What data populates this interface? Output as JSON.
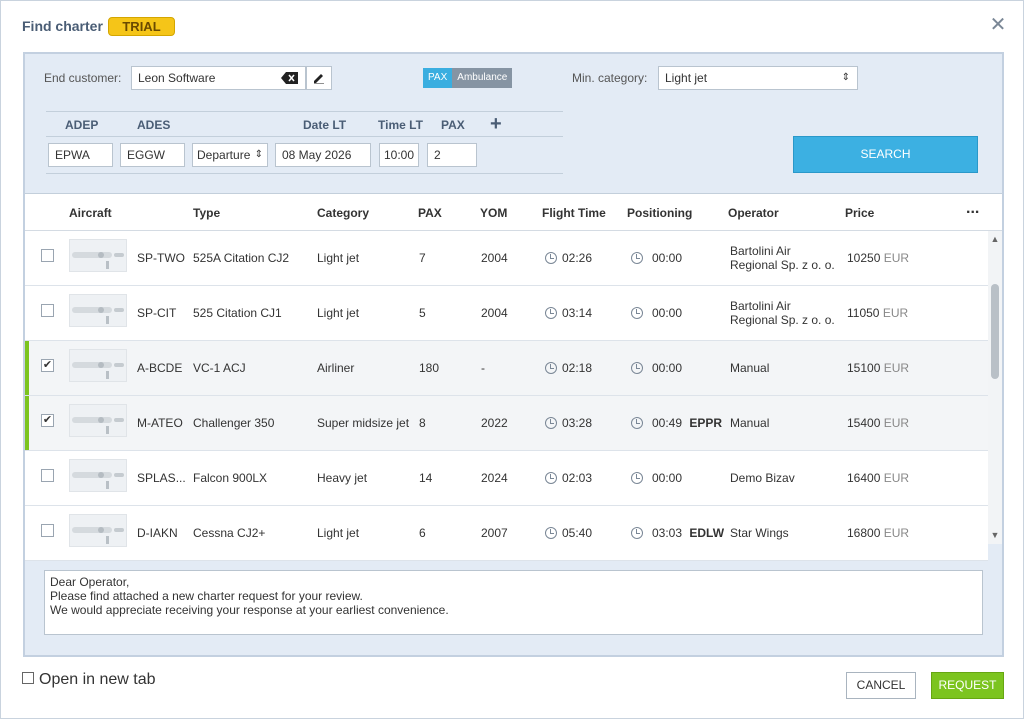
{
  "dialog": {
    "title": "Find charter",
    "badge": "TRIAL",
    "close_icon": "close-icon"
  },
  "filters": {
    "end_customer_label": "End customer:",
    "end_customer_value": "Leon Software",
    "toggle": {
      "pax": "PAX",
      "ambulance": "Ambulance",
      "selected": "PAX"
    },
    "min_category_label": "Min. category:",
    "min_category_value": "Light jet"
  },
  "route": {
    "headers": [
      "ADEP",
      "ADES",
      "Date LT",
      "Time LT",
      "PAX"
    ],
    "adep": "EPWA",
    "ades": "EGGW",
    "mode": "Departure",
    "date": "08 May 2026",
    "time": "10:00",
    "pax": "2"
  },
  "search_label": "SEARCH",
  "table": {
    "headers": [
      "Aircraft",
      "Type",
      "Category",
      "PAX",
      "YOM",
      "Flight Time",
      "Positioning",
      "Operator",
      "Price"
    ],
    "more_icon": "...",
    "rows": [
      {
        "reg": "SP-TWO",
        "type": "525A Citation CJ2",
        "category": "Light jet",
        "pax": "7",
        "yom": "2004",
        "flight_time": "02:26",
        "positioning": "00:00",
        "pos_airport": "",
        "operator1": "Bartolini Air",
        "operator2": "Regional Sp. z o. o.",
        "price": "10250",
        "currency": "EUR",
        "checked": false
      },
      {
        "reg": "SP-CIT",
        "type": "525 Citation CJ1",
        "category": "Light jet",
        "pax": "5",
        "yom": "2004",
        "flight_time": "03:14",
        "positioning": "00:00",
        "pos_airport": "",
        "operator1": "Bartolini Air",
        "operator2": "Regional Sp. z o. o.",
        "price": "11050",
        "currency": "EUR",
        "checked": false
      },
      {
        "reg": "A-BCDE",
        "type": "VC-1 ACJ",
        "category": "Airliner",
        "pax": "180",
        "yom": "-",
        "flight_time": "02:18",
        "positioning": "00:00",
        "pos_airport": "",
        "operator1": "Manual",
        "operator2": "",
        "price": "15100",
        "currency": "EUR",
        "checked": true
      },
      {
        "reg": "M-ATEO",
        "type": "Challenger 350",
        "category": "Super midsize jet",
        "pax": "8",
        "yom": "2022",
        "flight_time": "03:28",
        "positioning": "00:49",
        "pos_airport": "EPPR",
        "operator1": "Manual",
        "operator2": "",
        "price": "15400",
        "currency": "EUR",
        "checked": true
      },
      {
        "reg": "SPLAS...",
        "type": "Falcon 900LX",
        "category": "Heavy jet",
        "pax": "14",
        "yom": "2024",
        "flight_time": "02:03",
        "positioning": "00:00",
        "pos_airport": "",
        "operator1": "Demo Bizav",
        "operator2": "",
        "price": "16400",
        "currency": "EUR",
        "checked": false
      },
      {
        "reg": "D-IAKN",
        "type": "Cessna CJ2+",
        "category": "Light jet",
        "pax": "6",
        "yom": "2007",
        "flight_time": "05:40",
        "positioning": "03:03",
        "pos_airport": "EDLW",
        "operator1": "Star Wings",
        "operator2": "",
        "price": "16800",
        "currency": "EUR",
        "checked": false
      }
    ]
  },
  "message": {
    "line1": "Dear Operator,",
    "line2": "Please find attached a new charter request for your review.",
    "line3": "We would appreciate receiving your response at your earliest convenience."
  },
  "footer": {
    "open_new_tab": "Open in new tab",
    "cancel": "CANCEL",
    "request": "REQUEST"
  },
  "colors": {
    "accent": "#3cb0e2",
    "request": "#7cc41f",
    "trial": "#f5c518",
    "selected_mark": "#7cc41f"
  }
}
